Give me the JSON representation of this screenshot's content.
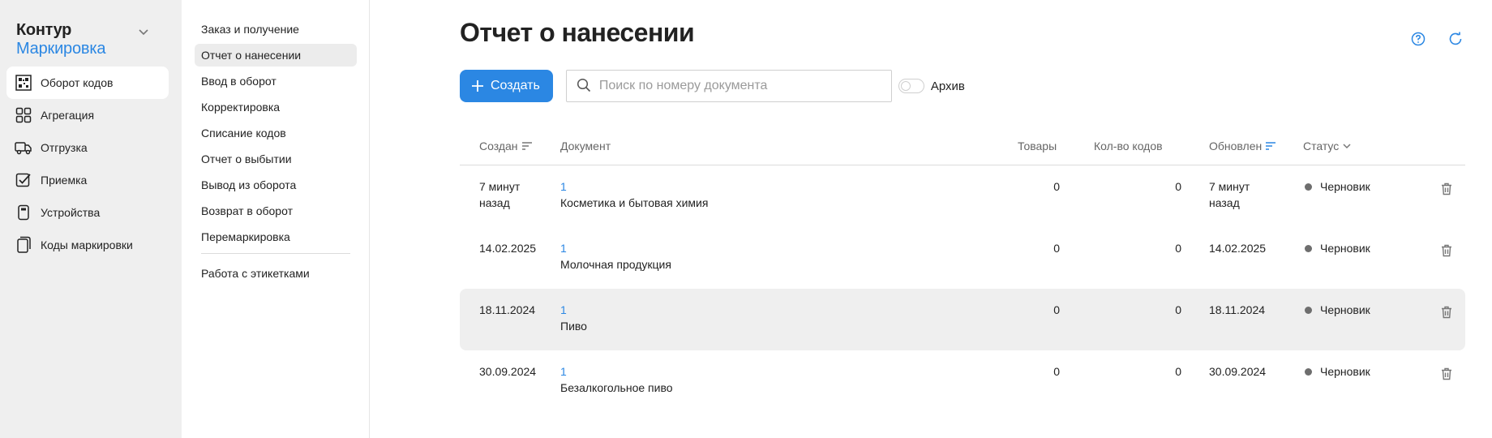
{
  "brand": {
    "line1": "Контур",
    "line2": "Маркировка"
  },
  "sidebar": {
    "items": [
      {
        "label": "Оборот кодов",
        "icon": "qr-code-icon",
        "active": true
      },
      {
        "label": "Агрегация",
        "icon": "grid-icon"
      },
      {
        "label": "Отгрузка",
        "icon": "truck-icon"
      },
      {
        "label": "Приемка",
        "icon": "checkbox-icon"
      },
      {
        "label": "Устройства",
        "icon": "device-icon"
      },
      {
        "label": "Коды маркировки",
        "icon": "codes-icon"
      }
    ]
  },
  "subnav": {
    "items": [
      {
        "label": "Заказ и получение"
      },
      {
        "label": "Отчет о нанесении",
        "active": true
      },
      {
        "label": "Ввод в оборот"
      },
      {
        "label": "Корректировка"
      },
      {
        "label": "Списание кодов"
      },
      {
        "label": "Отчет о выбытии"
      },
      {
        "label": "Вывод из оборота"
      },
      {
        "label": "Возврат в оборот"
      },
      {
        "label": "Перемаркировка"
      }
    ],
    "extra": {
      "label": "Работа с этикетками"
    }
  },
  "main": {
    "title": "Отчет о нанесении",
    "create_label": "Создать",
    "search_placeholder": "Поиск по номеру документа",
    "search_value": "",
    "archive_label": "Архив",
    "archive_on": false
  },
  "table": {
    "headers": {
      "created": "Создан",
      "document": "Документ",
      "goods": "Товары",
      "codes": "Кол-во кодов",
      "updated": "Обновлен",
      "status": "Статус"
    },
    "rows": [
      {
        "created": "7 минут назад",
        "doc_num": "1",
        "doc_name": "Косметика и бытовая химия",
        "goods": "0",
        "codes": "0",
        "updated": "7 минут назад",
        "status": "Черновик"
      },
      {
        "created": "14.02.2025",
        "doc_num": "1",
        "doc_name": "Молочная продукция",
        "goods": "0",
        "codes": "0",
        "updated": "14.02.2025",
        "status": "Черновик"
      },
      {
        "created": "18.11.2024",
        "doc_num": "1",
        "doc_name": "Пиво",
        "goods": "0",
        "codes": "0",
        "updated": "18.11.2024",
        "status": "Черновик",
        "hover": true
      },
      {
        "created": "30.09.2024",
        "doc_num": "1",
        "doc_name": "Безалкогольное пиво",
        "goods": "0",
        "codes": "0",
        "updated": "30.09.2024",
        "status": "Черновик"
      }
    ]
  },
  "colors": {
    "accent": "#2b87e3",
    "sidebar_bg": "#efefef",
    "status_dot": "#6e6e6e"
  }
}
